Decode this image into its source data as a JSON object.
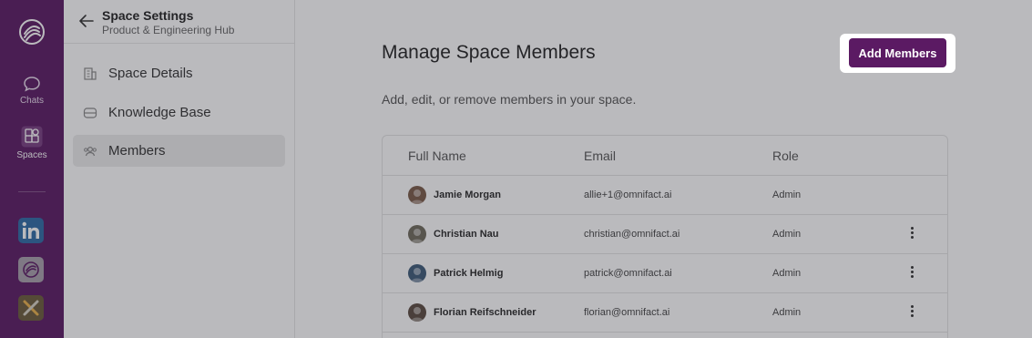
{
  "rail": {
    "items": [
      {
        "label": "Chats",
        "icon": "chat-bubble-icon"
      },
      {
        "label": "Spaces",
        "icon": "spaces-grid-icon"
      }
    ],
    "apps": [
      {
        "name": "linkedin-app-tile",
        "color": "#2f6aa6"
      },
      {
        "name": "omnifact-app-tile",
        "color": "#a9a0ac"
      },
      {
        "name": "tools-app-tile",
        "color": "#6b5a3a"
      }
    ]
  },
  "settings": {
    "title": "Space Settings",
    "subtitle": "Product & Engineering Hub",
    "nav": [
      {
        "label": "Space Details",
        "icon": "building-icon"
      },
      {
        "label": "Knowledge Base",
        "icon": "database-icon"
      },
      {
        "label": "Members",
        "icon": "users-icon"
      }
    ]
  },
  "main": {
    "title": "Manage Space Members",
    "description": "Add, edit, or remove members in your space.",
    "add_button": "Add Members",
    "table": {
      "headers": [
        "Full Name",
        "Email",
        "Role"
      ],
      "rows": [
        {
          "name": "Jamie Morgan",
          "email": "allie+1@omnifact.ai",
          "role": "Admin",
          "menu": false,
          "avatar": "#7a5a48"
        },
        {
          "name": "Christian Nau",
          "email": "christian@omnifact.ai",
          "role": "Admin",
          "menu": true,
          "avatar": "#6f6a5c"
        },
        {
          "name": "Patrick Helmig",
          "email": "patrick@omnifact.ai",
          "role": "Admin",
          "menu": true,
          "avatar": "#3d5a78"
        },
        {
          "name": "Florian Reifschneider",
          "email": "florian@omnifact.ai",
          "role": "Admin",
          "menu": true,
          "avatar": "#5a4a40"
        }
      ]
    }
  },
  "colors": {
    "brand": "#5b1a63"
  }
}
